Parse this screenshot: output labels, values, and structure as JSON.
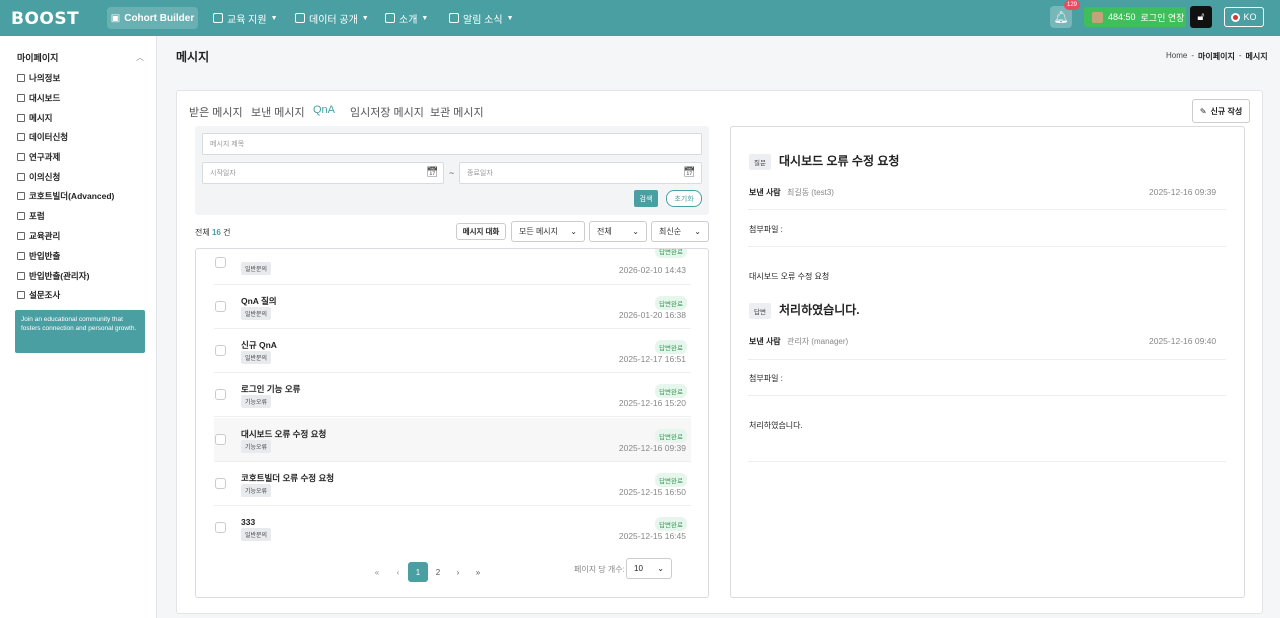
{
  "brand": {
    "logo": "BOOST",
    "accent": "#4a9fa3"
  },
  "topnav": {
    "cohort": "Cohort Builder",
    "menus": [
      "교육 지원",
      "데이터 공개",
      "소개",
      "알림 소식"
    ],
    "notif_count": "129",
    "timer": "484:50",
    "extend_label": "로그인 연장",
    "lang": "KO"
  },
  "sidebar": {
    "title": "마이페이지",
    "items": [
      "나의정보",
      "대시보드",
      "메시지",
      "데이터신청",
      "연구과제",
      "이의신청",
      "코호트빌더(Advanced)",
      "포럼",
      "교육관리",
      "반입반출",
      "반입반출(관리자)",
      "설문조사"
    ],
    "note": "Join an educational community that fosters connection and personal growth."
  },
  "page": {
    "title": "메시지",
    "breadcrumb": [
      "Home",
      "마이페이지",
      "메시지"
    ]
  },
  "tabs": [
    "받은 메시지",
    "보낸 메시지",
    "QnA",
    "임시저장 메시지",
    "보관 메시지"
  ],
  "new_button": "신규 작성",
  "filter": {
    "title_placeholder": "메시지 제목",
    "start_placeholder": "시작일자",
    "end_placeholder": "종료일자",
    "tilde": "~",
    "search": "검색",
    "reset": "초기화"
  },
  "list": {
    "total_prefix": "전체",
    "total": "16",
    "total_suffix": "건",
    "conversation": "메시지 대화",
    "select_type": "모든 메시지",
    "select_scope": "전체",
    "select_sort": "최신순",
    "rows": [
      {
        "title": "",
        "tag": "일반문의",
        "status": "답변완료",
        "date": "2026-02-10 14:43"
      },
      {
        "title": "QnA 질의",
        "tag": "일반문의",
        "status": "답변완료",
        "date": "2026-01-20 16:38"
      },
      {
        "title": "신규 QnA",
        "tag": "일반문의",
        "status": "답변완료",
        "date": "2025-12-17 16:51"
      },
      {
        "title": "로그인 기능 오류",
        "tag": "기능오류",
        "status": "답변완료",
        "date": "2025-12-16 15:20"
      },
      {
        "title": "대시보드 오류 수정 요청",
        "tag": "기능오류",
        "status": "답변완료",
        "date": "2025-12-16 09:39"
      },
      {
        "title": "코호트빌더 오류 수정 요청",
        "tag": "기능오류",
        "status": "답변완료",
        "date": "2025-12-15 16:50"
      },
      {
        "title": "333",
        "tag": "일반문의",
        "status": "답변완료",
        "date": "2025-12-15 16:45"
      }
    ],
    "pages": [
      "1",
      "2"
    ],
    "per_page_label": "페이지 당 개수:",
    "per_page": "10"
  },
  "detail": {
    "question_badge": "질문",
    "question_title": "대시보드 오류 수정 요청",
    "sender_label": "보낸 사람",
    "q_sender": "최길동 (test3)",
    "q_date": "2025-12-16 09:39",
    "attach_label": "첨부파일 :",
    "q_body": "대시보드 오류 수정 요청",
    "answer_badge": "답변",
    "answer_title": "처리하였습니다.",
    "a_sender": "관리자 (manager)",
    "a_date": "2025-12-16 09:40",
    "a_body": "처리하였습니다."
  }
}
